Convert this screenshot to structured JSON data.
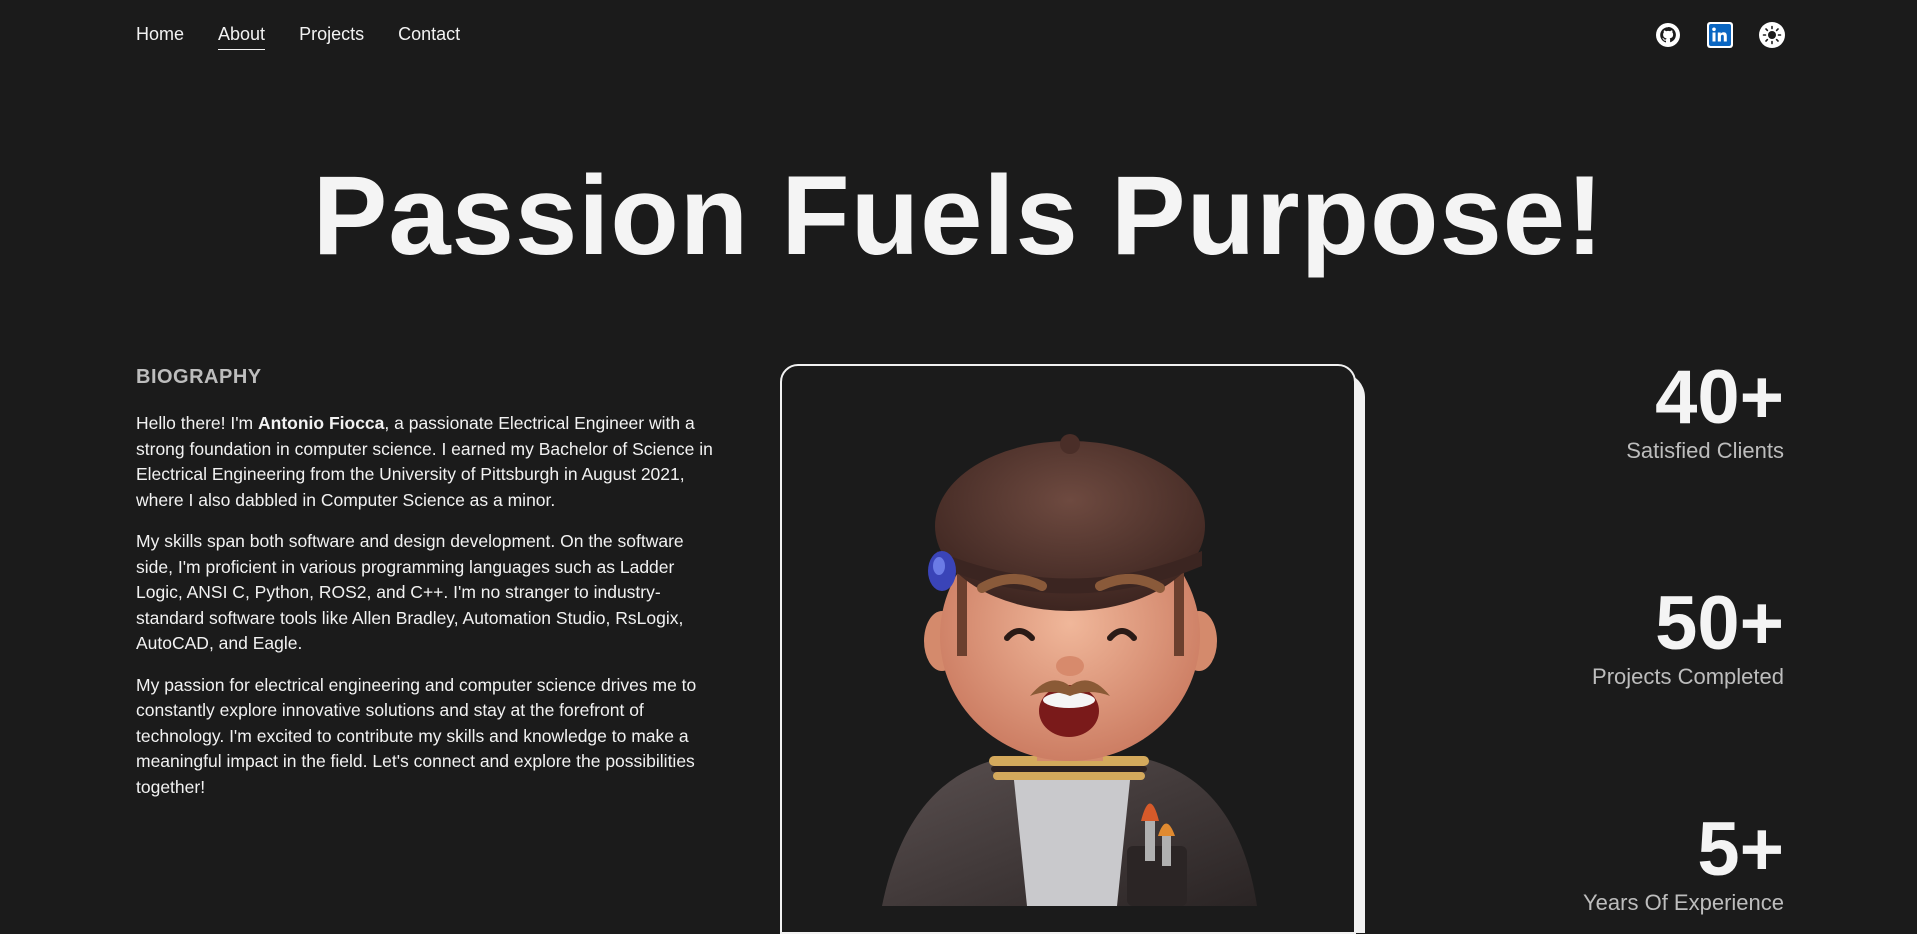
{
  "nav": {
    "items": [
      {
        "label": "Home"
      },
      {
        "label": "About"
      },
      {
        "label": "Projects"
      },
      {
        "label": "Contact"
      }
    ],
    "active": "About"
  },
  "social": {
    "icons": [
      "github-icon",
      "linkedin-icon",
      "theme-toggle-icon"
    ]
  },
  "hero": {
    "title": "Passion Fuels Purpose!"
  },
  "biography": {
    "heading": "BIOGRAPHY",
    "p1_before": "Hello there! I'm ",
    "p1_name": "Antonio Fiocca",
    "p1_after": ", a passionate Electrical Engineer with a strong foundation in computer science. I earned my Bachelor of Science in Electrical Engineering from the University of Pittsburgh in August 2021, where I also dabbled in Computer Science as a minor.",
    "p2": "My skills span both software and design development. On the software side, I'm proficient in various programming languages such as Ladder Logic, ANSI C, Python, ROS2, and C++. I'm no stranger to industry-standard software tools like Allen Bradley, Automation Studio, RsLogix, AutoCAD, and Eagle.",
    "p3": "My passion for electrical engineering and computer science drives me to constantly explore innovative solutions and stay at the forefront of technology. I'm excited to contribute my skills and knowledge to make a meaningful impact in the field. Let's connect and explore the possibilities together!"
  },
  "stats": [
    {
      "value": "40+",
      "label": "Satisfied Clients"
    },
    {
      "value": "50+",
      "label": "Projects Completed"
    },
    {
      "value": "5+",
      "label": "Years Of Experience"
    }
  ],
  "colors": {
    "background": "#1b1b1b",
    "text": "#f2f2f2",
    "muted": "#bdbdbd",
    "linkedin": "#0a66c2"
  }
}
